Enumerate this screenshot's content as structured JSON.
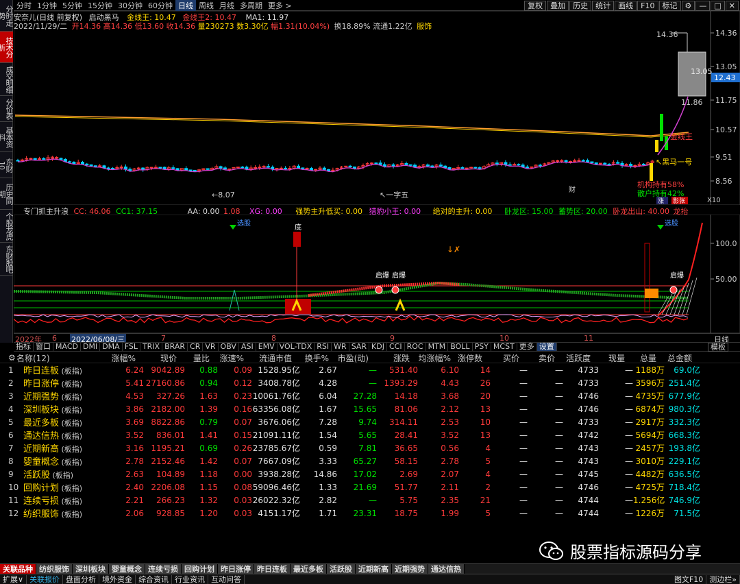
{
  "vtabs": [
    "分时走势",
    "技术分析",
    "成交明细",
    "分价表",
    "基本资料",
    "东财10",
    "历史同期",
    "个股龙虎",
    "东财股吧"
  ],
  "vtab_active": 1,
  "toolbar": {
    "periods": [
      "分时",
      "1分钟",
      "5分钟",
      "15分钟",
      "30分钟",
      "60分钟",
      "日线",
      "周线",
      "月线",
      "多周期",
      "更多 >"
    ],
    "active_period": "日线",
    "right_buttons": [
      "复权",
      "叠加",
      "历史",
      "统计",
      "画线",
      "F10",
      "标记",
      "⚙"
    ]
  },
  "info1": {
    "stock": "安奈儿(日线 前复权)",
    "indicator": "启动黑马",
    "jxw": "金线王: 10.47",
    "jxw2": "金线王2: 10.47",
    "ma1": "MA1: 11.97"
  },
  "info2": {
    "date": "2022/11/29/二",
    "open": "开14.36",
    "high": "高14.36",
    "low": "低13.60",
    "close": "收14.36",
    "vol": "量230273",
    "amount": "数3.30亿",
    "rise": "幅1.31(10.04%)",
    "turnover": "换18.89%",
    "flow": "流通1.22亿",
    "sector": "服饰"
  },
  "price_axis": [
    "14.36",
    "13.05",
    "11.75",
    "10.57",
    "9.51",
    "8.56"
  ],
  "price_current": "12.43",
  "chart_labels": {
    "high": "14.36",
    "open_box": "13.05",
    "low": "11.86",
    "min": "8.07",
    "heima": "黑马一号",
    "jxw_label": "金线王",
    "yiqian": "一字五",
    "lx1": "机构持有58%",
    "lx2": "散户持有42%",
    "cai": "财",
    "bottom_btn": "涨",
    "hot": "影张",
    "x10": "X10"
  },
  "sub_info": {
    "name": "专门抓主升浪",
    "cc": "CC: 46.06",
    "cc1": "CC1: 37.15",
    "aa": "AA: 0.00",
    "aa2": "1.08",
    "xg": "XG: 0.00",
    "qs": "强势主升低买: 0.00",
    "sz": "猎豹小王: 0.00",
    "jd": "绝对的主升: 0.00",
    "wl": "卧龙区: 15.00",
    "xs": "蓄势区: 20.00",
    "wlcs": "卧龙出山: 40.00",
    "lt": "龙抬"
  },
  "sub_axis": [
    "100.0",
    "50.00"
  ],
  "sub_labels": {
    "xuan": "选股",
    "di": "底",
    "qi1": "启爆",
    "qi2": "启爆",
    "qi3": "启爆",
    "xuan2": "选股"
  },
  "date_axis": [
    "2022年",
    "6",
    "2022/06/08/三",
    "7",
    "8",
    "9",
    "10",
    "11",
    "日线"
  ],
  "ind_tabs": [
    "指标",
    "窗口",
    "MACD",
    "DMI",
    "DMA",
    "FSL",
    "TRIX",
    "BRAR",
    "CR",
    "VR",
    "OBV",
    "ASI",
    "EMV",
    "VOL-TDX",
    "RSI",
    "WR",
    "SAR",
    "KDJ",
    "CCI",
    "ROC",
    "MTM",
    "BOLL",
    "PSY",
    "MCST",
    "更多",
    "设置"
  ],
  "ind_right": "模板",
  "table": {
    "headers": [
      "名称(12)",
      "涨幅%",
      "现价",
      "量比",
      "涨速%",
      "流通市值",
      "换手%",
      "市盈(动)",
      "涨跌",
      "均涨幅%",
      "涨停数",
      "买价",
      "卖价",
      "活跃度",
      "现量",
      "总量",
      "总金额"
    ],
    "rows": [
      [
        "1",
        "昨日连板",
        "6.24",
        "9042.89",
        "0.88",
        "0.09",
        "1528.95亿",
        "2.67",
        "—",
        "531.40",
        "6.10",
        "14",
        "—",
        "—",
        "4733",
        "—",
        "1188万",
        "69.0亿"
      ],
      [
        "2",
        "昨日涨停",
        "5.41",
        "27160.86",
        "0.94",
        "0.12",
        "3408.78亿",
        "4.28",
        "—",
        "1393.29",
        "4.43",
        "26",
        "—",
        "—",
        "4733",
        "—",
        "3596万",
        "251.4亿"
      ],
      [
        "3",
        "近期强势",
        "4.53",
        "327.26",
        "1.63",
        "0.23",
        "10061.76亿",
        "6.04",
        "27.28",
        "14.18",
        "3.68",
        "20",
        "—",
        "—",
        "4746",
        "—",
        "4735万",
        "677.9亿"
      ],
      [
        "4",
        "深圳板块",
        "3.86",
        "2182.00",
        "1.39",
        "0.16",
        "63356.08亿",
        "1.67",
        "15.65",
        "81.06",
        "2.12",
        "13",
        "—",
        "—",
        "4746",
        "—",
        "6874万",
        "980.3亿"
      ],
      [
        "5",
        "最近多板",
        "3.69",
        "8822.86",
        "0.79",
        "0.07",
        "3676.06亿",
        "7.28",
        "9.74",
        "314.11",
        "2.53",
        "10",
        "—",
        "—",
        "4733",
        "—",
        "2917万",
        "332.3亿"
      ],
      [
        "6",
        "通达信热",
        "3.52",
        "836.01",
        "1.41",
        "0.15",
        "21091.11亿",
        "1.54",
        "5.65",
        "28.41",
        "3.52",
        "13",
        "—",
        "—",
        "4742",
        "—",
        "5694万",
        "668.3亿"
      ],
      [
        "7",
        "近期新高",
        "3.16",
        "1195.21",
        "0.69",
        "0.26",
        "23785.67亿",
        "0.59",
        "7.81",
        "36.65",
        "0.56",
        "4",
        "—",
        "—",
        "4743",
        "—",
        "2457万",
        "193.8亿"
      ],
      [
        "8",
        "婴童概念",
        "2.78",
        "2152.46",
        "1.42",
        "0.07",
        "7667.09亿",
        "3.33",
        "65.27",
        "58.15",
        "2.78",
        "5",
        "—",
        "—",
        "4743",
        "—",
        "3010万",
        "229.1亿"
      ],
      [
        "9",
        "活跃股",
        "2.63",
        "104.89",
        "1.18",
        "0.00",
        "3938.28亿",
        "14.86",
        "17.02",
        "2.69",
        "2.07",
        "4",
        "—",
        "—",
        "4745",
        "—",
        "4482万",
        "636.5亿"
      ],
      [
        "10",
        "回购计划",
        "2.40",
        "2206.08",
        "1.15",
        "0.08",
        "59096.46亿",
        "1.33",
        "21.69",
        "51.77",
        "2.11",
        "2",
        "—",
        "—",
        "4746",
        "—",
        "4725万",
        "718.4亿"
      ],
      [
        "11",
        "连续亏损",
        "2.21",
        "266.23",
        "1.32",
        "0.03",
        "26022.32亿",
        "2.82",
        "—",
        "5.75",
        "2.35",
        "21",
        "—",
        "—",
        "4744",
        "—",
        "1.256亿",
        "746.9亿"
      ],
      [
        "12",
        "纺织服饰",
        "2.06",
        "928.85",
        "1.20",
        "0.03",
        "4151.17亿",
        "1.71",
        "23.31",
        "18.75",
        "1.99",
        "5",
        "—",
        "—",
        "4744",
        "—",
        "1226万",
        "71.5亿"
      ]
    ],
    "tag": "(板指)"
  },
  "bottom_tabs": [
    "关联品种",
    "纺织服饰",
    "深圳板块",
    "婴童概念",
    "连续亏损",
    "回购计划",
    "昨日涨停",
    "昨日连板",
    "最近多板",
    "活跃股",
    "近期新高",
    "近期强势",
    "通达信热"
  ],
  "status_items": [
    "扩展∨",
    "关联报价",
    "盘面分析",
    "境外资金",
    "综合资讯",
    "行业资讯",
    "互动问答"
  ],
  "status_right": [
    "图文F10",
    "测边栏»"
  ],
  "watermark": "股票指标源码分享",
  "colors": {
    "up": "#ff3a3a",
    "down": "#00e000",
    "accent": "#ffd700",
    "bg": "#000000"
  }
}
